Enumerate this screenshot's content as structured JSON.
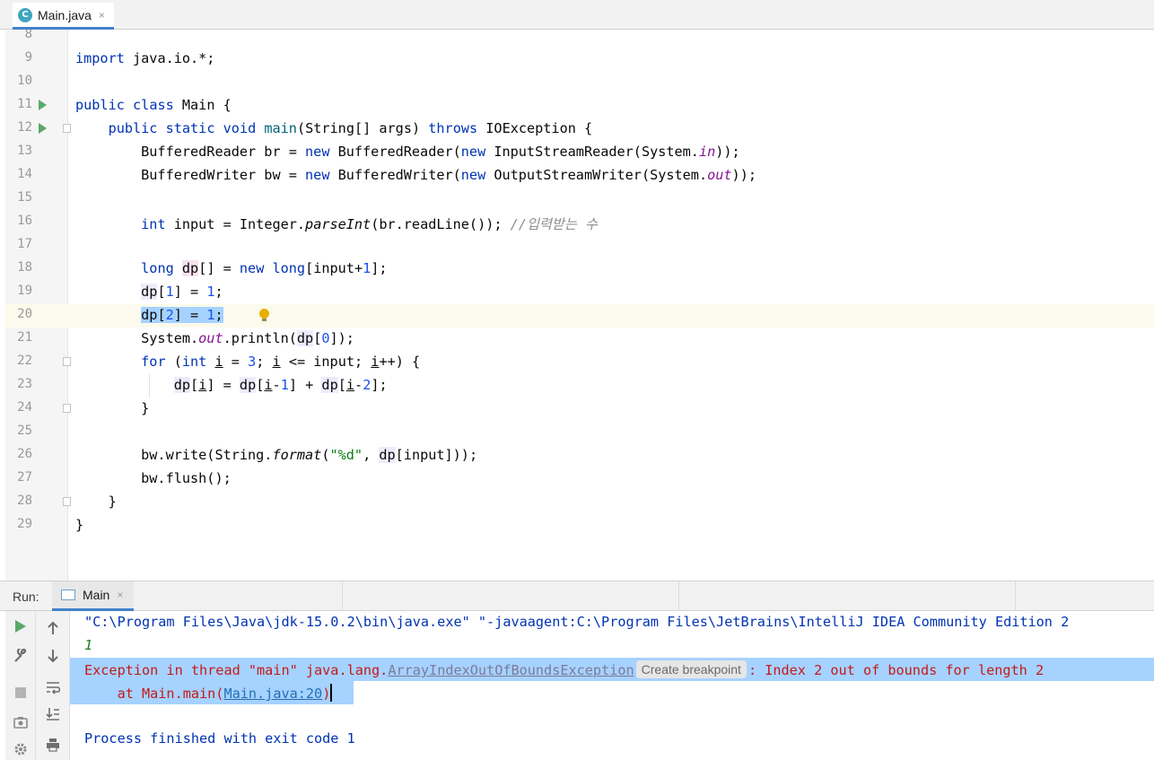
{
  "editor_tab": {
    "icon": "class-file-icon",
    "label": "Main.java",
    "close": "×"
  },
  "code_lines": [
    {
      "num": "8"
    },
    {
      "num": "9"
    },
    {
      "num": "10"
    },
    {
      "num": "11"
    },
    {
      "num": "12"
    },
    {
      "num": "13"
    },
    {
      "num": "14"
    },
    {
      "num": "15"
    },
    {
      "num": "16"
    },
    {
      "num": "17"
    },
    {
      "num": "18"
    },
    {
      "num": "19"
    },
    {
      "num": "20"
    },
    {
      "num": "21"
    },
    {
      "num": "22"
    },
    {
      "num": "23"
    },
    {
      "num": "24"
    },
    {
      "num": "25"
    },
    {
      "num": "26"
    },
    {
      "num": "27"
    },
    {
      "num": "28"
    },
    {
      "num": "29"
    }
  ],
  "code": {
    "l9": [
      "import",
      " java.io.*;"
    ],
    "l11": [
      "public",
      " ",
      "class",
      " Main {"
    ],
    "l12": [
      "    ",
      "public",
      " ",
      "static",
      " ",
      "void",
      " ",
      "main",
      "(String[] args) ",
      "throws",
      " IOException {"
    ],
    "l13": [
      "        BufferedReader br = ",
      "new",
      " BufferedReader(",
      "new",
      " InputStreamReader(System.",
      "in",
      "));"
    ],
    "l14": [
      "        BufferedWriter bw = ",
      "new",
      " BufferedWriter(",
      "new",
      " OutputStreamWriter(System.",
      "out",
      "));"
    ],
    "l16": [
      "        ",
      "int",
      " input = Integer.",
      "parseInt",
      "(br.readLine()); ",
      "//입력받는 수"
    ],
    "l18": [
      "        ",
      "long",
      " ",
      "dp",
      "[] = ",
      "new",
      " ",
      "long",
      "[input+",
      "1",
      "];"
    ],
    "l19": [
      "        ",
      "dp",
      "[",
      "1",
      "] = ",
      "1",
      ";"
    ],
    "l20": [
      "        ",
      "dp[",
      "2",
      "] = ",
      "1",
      ";"
    ],
    "l21": [
      "        System.",
      "out",
      ".println(",
      "dp",
      "[",
      "0",
      "]);"
    ],
    "l22": [
      "        ",
      "for",
      " (",
      "int",
      " ",
      "i",
      " = ",
      "3",
      "; ",
      "i",
      " <= input; ",
      "i",
      "++) {"
    ],
    "l23": [
      "            ",
      "dp",
      "[",
      "i",
      "] = ",
      "dp",
      "[",
      "i",
      "-",
      "1",
      "] + ",
      "dp",
      "[",
      "i",
      "-",
      "2",
      "];"
    ],
    "l24": [
      "        }"
    ],
    "l26": [
      "        bw.write(String.",
      "format",
      "(",
      "\"%d\"",
      ", ",
      "dp",
      "[input]));"
    ],
    "l27": [
      "        bw.flush();"
    ],
    "l28": [
      "    }"
    ],
    "l29": [
      "}"
    ]
  },
  "run_panel": {
    "label": "Run:",
    "tab_label": "Main",
    "tab_close": "×"
  },
  "console": {
    "cmd": "\"C:\\Program Files\\Java\\jdk-15.0.2\\bin\\java.exe\" \"-javaagent:C:\\Program Files\\JetBrains\\IntelliJ IDEA Community Edition 2",
    "output": "1",
    "exception_prefix": "Exception in thread \"main\" java.lang.",
    "exception_class": "ArrayIndexOutOfBoundsException",
    "create_breakpoint": "Create breakpoint",
    "exception_suffix": ": Index 2 out of bounds for length 2",
    "at_prefix": "    at Main.main(",
    "at_link": "Main.java:20",
    "at_suffix": ")",
    "finished": "Process finished with exit code 1"
  },
  "toolbar_icons": [
    "rerun-icon",
    "wrench-icon",
    "stop-icon",
    "camera-icon",
    "gear-icon",
    "up-arrow-icon",
    "down-arrow-icon",
    "soft-wrap-icon",
    "scroll-to-end-icon",
    "print-icon"
  ]
}
